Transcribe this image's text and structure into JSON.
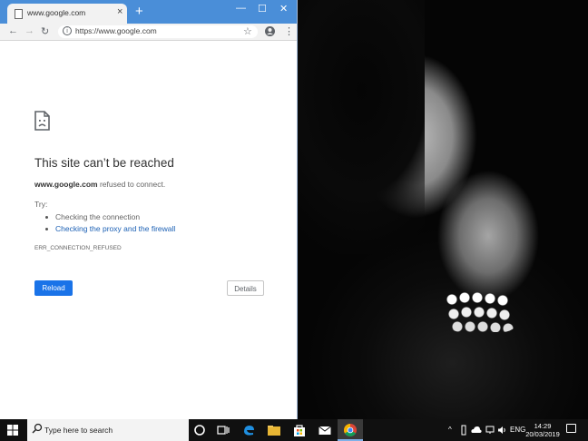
{
  "browser": {
    "tab_title": "www.google.com",
    "tab_close": "×",
    "new_tab": "+",
    "minimize": "—",
    "maximize": "☐",
    "close": "✕",
    "back": "←",
    "forward": "→",
    "reload_icon": "↻",
    "url": "https://www.google.com",
    "info_glyph": "i",
    "star": "☆",
    "menu": "⋮"
  },
  "error_page": {
    "title": "This site can’t be reached",
    "domain": "www.google.com",
    "message": "refused to connect.",
    "try_label": "Try:",
    "suggestions": [
      "Checking the connection",
      "Checking the proxy and the firewall"
    ],
    "error_code": "ERR_CONNECTION_REFUSED",
    "reload_button": "Reload",
    "details_button": "Details"
  },
  "taskbar": {
    "search_placeholder": "Type here to search",
    "tray_lang": "ENG",
    "tray_chevron": "^",
    "time": "14:29",
    "date": "20/03/2019"
  },
  "colors": {
    "accent": "#1a73e8",
    "titlebar": "#4a8ed8",
    "link": "#1a5fb4"
  },
  "icons": [
    "page-icon",
    "sad-page-icon",
    "back-icon",
    "forward-icon",
    "reload-icon",
    "info-icon",
    "star-icon",
    "profile-icon",
    "menu-icon",
    "windows-start-icon",
    "search-icon",
    "task-view-icon",
    "edge-icon",
    "file-explorer-icon",
    "store-icon",
    "mail-icon",
    "chrome-icon",
    "cortana-icon",
    "notification-icon"
  ]
}
